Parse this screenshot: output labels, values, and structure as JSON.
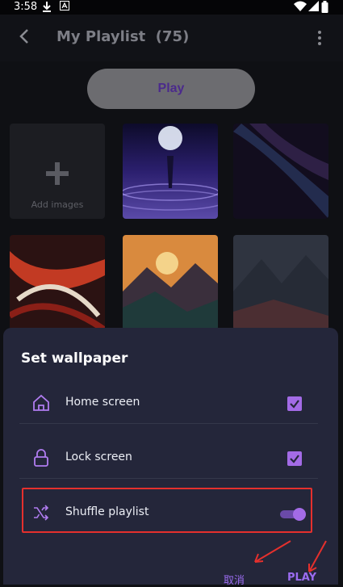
{
  "status_bar": {
    "time": "3:58"
  },
  "app_bar": {
    "title": "My Playlist  (75)"
  },
  "play_button": {
    "label": "Play"
  },
  "grid": {
    "add_images_label": "Add images"
  },
  "sheet": {
    "title": "Set wallpaper",
    "options": [
      {
        "label": "Home screen",
        "icon": "home-icon",
        "checked": true
      },
      {
        "label": "Lock screen",
        "icon": "lock-icon",
        "checked": true
      },
      {
        "label": "Shuffle playlist",
        "icon": "shuffle-icon",
        "toggle_on": true
      }
    ],
    "actions": {
      "cancel_label": "取消",
      "play_label": "PLAY"
    }
  },
  "colors": {
    "accent": "#a36be6",
    "sheet_bg": "#24263a",
    "annotation_red": "#e5302d"
  }
}
